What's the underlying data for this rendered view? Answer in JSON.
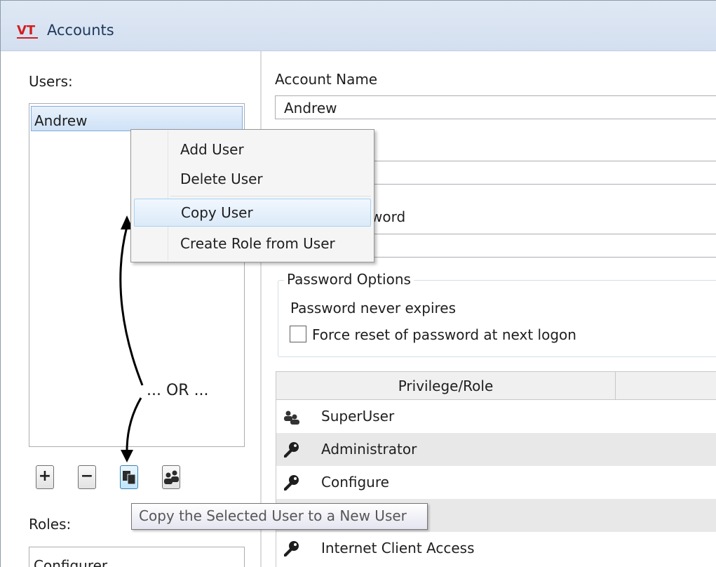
{
  "window": {
    "title": "Accounts",
    "logo_text": "VT"
  },
  "users": {
    "label": "Users:",
    "items": [
      "Andrew"
    ]
  },
  "user_toolbar": {
    "add": "+",
    "remove": "−"
  },
  "roles": {
    "label": "Roles:",
    "items": [
      "Configurer"
    ]
  },
  "context_menu": {
    "items": [
      "Add User",
      "Delete User",
      "Copy User",
      "Create Role from User"
    ],
    "highlighted_item": "Copy User"
  },
  "account": {
    "name_label": "Account Name",
    "name_value": "Andrew",
    "password_label_partial": "word"
  },
  "password_options": {
    "legend": "Password Options",
    "never_expires": "Password never expires",
    "force_reset_label": "Force reset of password at next logon",
    "force_reset_checked": false
  },
  "privileges": {
    "column_header": "Privilege/Role",
    "rows": [
      {
        "label": "SuperUser",
        "icon": "role-icon"
      },
      {
        "label": "Administrator",
        "icon": "key-icon"
      },
      {
        "label": "Configure",
        "icon": "key-icon"
      },
      {
        "label": "",
        "icon": ""
      },
      {
        "label": "Internet Client Access",
        "icon": "key-icon"
      }
    ]
  },
  "tooltip": "Copy the Selected User to a New User",
  "annotation": "... OR ...",
  "colors": {
    "selection": "#cfe2f7",
    "menu_highlight": "#dbeaf8",
    "logo_red": "#d21f1f"
  }
}
